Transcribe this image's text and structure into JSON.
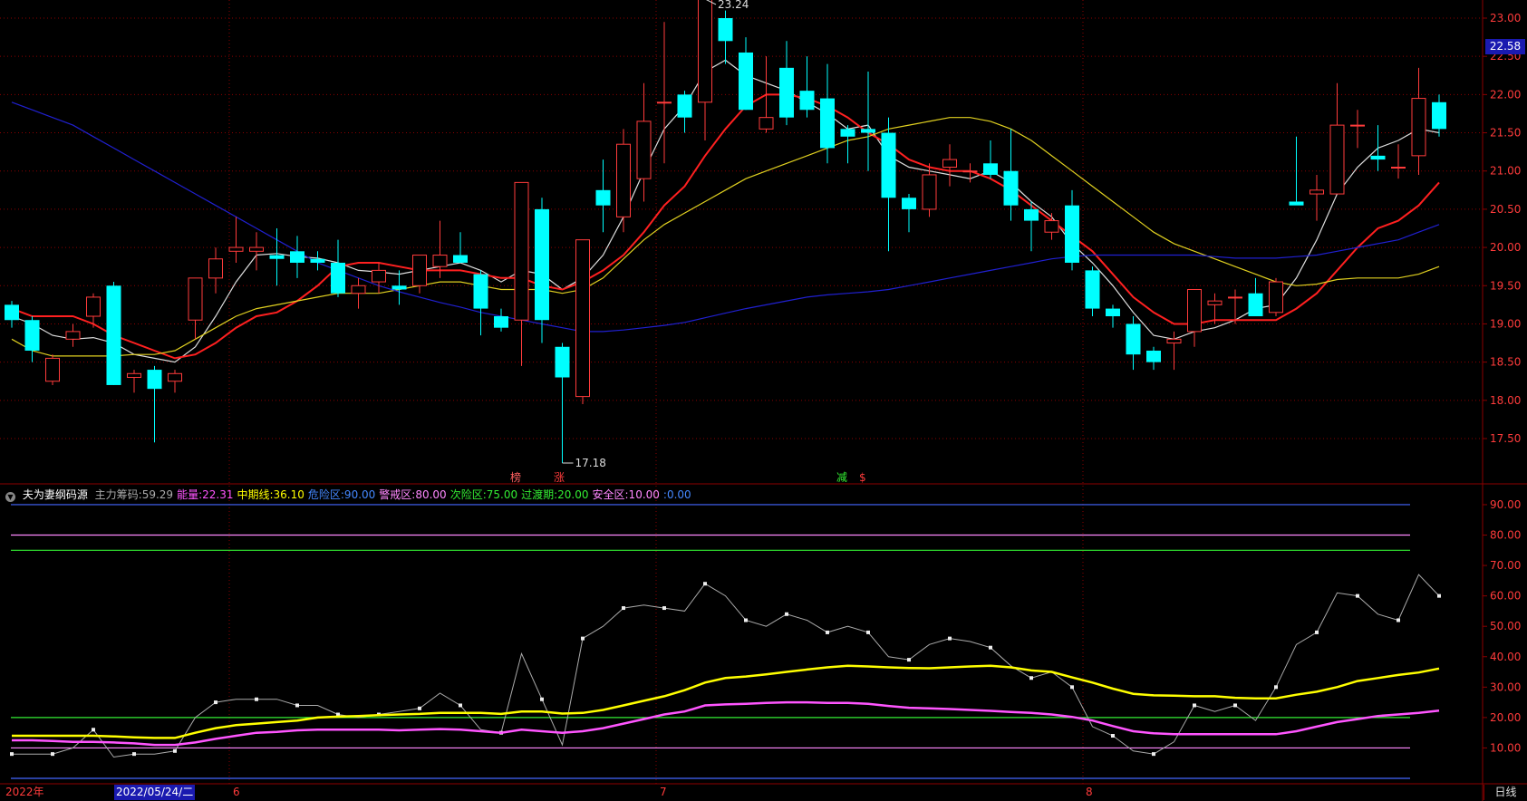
{
  "current_price": "22.58",
  "period": "日线",
  "indicator_header": {
    "name": "夫为妻纲码源",
    "items": [
      {
        "label": "主力筹码:",
        "value": "59.29",
        "color": "#aaaaaa"
      },
      {
        "label": "能量:",
        "value": "22.31",
        "color": "#ff55ff"
      },
      {
        "label": "中期线:",
        "value": "36.10",
        "color": "#ffff00"
      },
      {
        "label": "危险区:",
        "value": "90.00",
        "color": "#4488ff"
      },
      {
        "label": "警戒区:",
        "value": "80.00",
        "color": "#ff88ff"
      },
      {
        "label": "次险区:",
        "value": "75.00",
        "color": "#33ee33"
      },
      {
        "label": "过渡期:",
        "value": "20.00",
        "color": "#33ee33"
      },
      {
        "label": "安全区:",
        "value": "10.00",
        "color": "#ff88ff"
      },
      {
        "label": ":",
        "value": "0.00",
        "color": "#4488ff"
      }
    ]
  },
  "date_axis": {
    "year": "2022年",
    "cursor": "2022/05/24/二",
    "m6": "6",
    "m7": "7",
    "m8": "8"
  },
  "colors": {
    "up": "#ff3b3b",
    "down": "#00ffff",
    "ma_white": "#dddddd",
    "ma_red": "#ff2020",
    "ma_yellow": "#e0d020",
    "ma_blue": "#2020d0",
    "axis": "#8b0000",
    "energy": "#ff55ff",
    "midline": "#ffff00",
    "main": "#aaaaaa"
  },
  "chart_data": [
    {
      "type": "candlestick",
      "ylim": [
        17.0,
        23.2
      ],
      "yticks": [
        17.5,
        18.0,
        18.5,
        19.0,
        19.5,
        20.0,
        20.5,
        21.0,
        21.5,
        22.0,
        22.5,
        23.0
      ],
      "annotations": {
        "high_label": "23.24",
        "low_label": "17.18",
        "signals": [
          "榜",
          "涨",
          "减",
          "$"
        ]
      },
      "ohlc": [
        [
          19.25,
          19.3,
          18.95,
          19.05
        ],
        [
          19.05,
          19.1,
          18.5,
          18.65
        ],
        [
          18.25,
          18.6,
          18.2,
          18.55
        ],
        [
          18.8,
          19.0,
          18.7,
          18.9
        ],
        [
          19.1,
          19.4,
          18.95,
          19.35
        ],
        [
          19.5,
          19.55,
          18.2,
          18.2
        ],
        [
          18.3,
          18.4,
          18.1,
          18.35
        ],
        [
          18.4,
          18.45,
          17.45,
          18.15
        ],
        [
          18.25,
          18.4,
          18.1,
          18.35
        ],
        [
          19.05,
          19.6,
          18.8,
          19.6
        ],
        [
          19.6,
          20.0,
          19.4,
          19.85
        ],
        [
          19.95,
          20.4,
          19.8,
          20.0
        ],
        [
          19.95,
          20.2,
          19.7,
          20.0
        ],
        [
          19.9,
          20.25,
          19.5,
          19.85
        ],
        [
          19.95,
          20.15,
          19.6,
          19.8
        ],
        [
          19.85,
          19.95,
          19.7,
          19.8
        ],
        [
          19.8,
          20.1,
          19.35,
          19.4
        ],
        [
          19.4,
          19.6,
          19.2,
          19.5
        ],
        [
          19.55,
          19.8,
          19.4,
          19.7
        ],
        [
          19.5,
          19.7,
          19.25,
          19.45
        ],
        [
          19.5,
          19.8,
          19.4,
          19.9
        ],
        [
          19.75,
          20.35,
          19.6,
          19.9
        ],
        [
          19.9,
          20.2,
          19.8,
          19.8
        ],
        [
          19.65,
          19.7,
          18.85,
          19.2
        ],
        [
          19.1,
          19.2,
          18.9,
          18.95
        ],
        [
          19.05,
          20.85,
          18.45,
          20.85
        ],
        [
          20.5,
          20.65,
          18.75,
          19.05
        ],
        [
          18.7,
          18.75,
          17.18,
          18.3
        ],
        [
          18.05,
          20.1,
          17.95,
          20.1
        ],
        [
          20.75,
          21.15,
          20.2,
          20.55
        ],
        [
          20.4,
          21.55,
          20.2,
          21.35
        ],
        [
          20.9,
          22.15,
          20.6,
          21.65
        ],
        [
          21.9,
          22.95,
          21.1,
          21.9
        ],
        [
          22.0,
          22.05,
          21.5,
          21.7
        ],
        [
          21.9,
          23.24,
          21.4,
          23.25
        ],
        [
          23.0,
          23.1,
          22.4,
          22.7
        ],
        [
          22.55,
          22.75,
          21.8,
          21.8
        ],
        [
          21.55,
          22.5,
          21.5,
          21.7
        ],
        [
          22.35,
          22.7,
          21.6,
          21.7
        ],
        [
          22.05,
          22.5,
          21.7,
          21.8
        ],
        [
          21.95,
          22.4,
          21.1,
          21.3
        ],
        [
          21.55,
          21.6,
          21.1,
          21.45
        ],
        [
          21.55,
          22.3,
          21.0,
          21.5
        ],
        [
          21.5,
          21.7,
          19.95,
          20.65
        ],
        [
          20.65,
          20.7,
          20.2,
          20.5
        ],
        [
          20.5,
          21.1,
          20.4,
          20.95
        ],
        [
          21.05,
          21.35,
          20.8,
          21.15
        ],
        [
          21.0,
          21.1,
          20.85,
          21.0
        ],
        [
          21.1,
          21.4,
          20.9,
          20.95
        ],
        [
          21.0,
          21.55,
          20.35,
          20.55
        ],
        [
          20.5,
          20.6,
          19.95,
          20.35
        ],
        [
          20.2,
          20.45,
          20.1,
          20.35
        ],
        [
          20.55,
          20.75,
          19.7,
          19.8
        ],
        [
          19.7,
          19.75,
          19.1,
          19.2
        ],
        [
          19.2,
          19.25,
          18.95,
          19.1
        ],
        [
          19.0,
          19.1,
          18.4,
          18.6
        ],
        [
          18.65,
          18.7,
          18.4,
          18.5
        ],
        [
          18.75,
          18.9,
          18.4,
          18.8
        ],
        [
          18.9,
          19.45,
          18.7,
          19.45
        ],
        [
          19.25,
          19.4,
          19.0,
          19.3
        ],
        [
          19.35,
          19.45,
          19.0,
          19.35
        ],
        [
          19.4,
          19.6,
          19.1,
          19.1
        ],
        [
          19.15,
          19.6,
          19.1,
          19.55
        ],
        [
          20.6,
          21.45,
          20.6,
          20.55
        ],
        [
          20.7,
          20.95,
          20.35,
          20.75
        ],
        [
          20.7,
          22.15,
          20.7,
          21.6
        ],
        [
          21.6,
          21.8,
          21.3,
          21.6
        ],
        [
          21.2,
          21.6,
          21.0,
          21.15
        ],
        [
          21.05,
          21.35,
          20.9,
          21.05
        ],
        [
          21.2,
          22.35,
          20.95,
          21.95
        ],
        [
          21.9,
          22.0,
          21.45,
          21.55
        ]
      ],
      "series": [
        {
          "name": "",
          "color": "#dddddd",
          "values": [
            19.1,
            19.0,
            18.85,
            18.8,
            18.82,
            18.75,
            18.6,
            18.55,
            18.5,
            18.7,
            19.1,
            19.55,
            19.9,
            19.92,
            19.88,
            19.86,
            19.8,
            19.7,
            19.68,
            19.65,
            19.7,
            19.75,
            19.8,
            19.7,
            19.55,
            19.7,
            19.65,
            19.45,
            19.6,
            19.9,
            20.4,
            21.0,
            21.55,
            21.85,
            22.3,
            22.45,
            22.25,
            22.15,
            22.05,
            21.9,
            21.75,
            21.55,
            21.6,
            21.2,
            21.05,
            21.0,
            20.95,
            20.9,
            21.0,
            20.85,
            20.6,
            20.4,
            20.05,
            19.8,
            19.5,
            19.15,
            18.85,
            18.8,
            18.9,
            18.95,
            19.05,
            19.2,
            19.25,
            19.6,
            20.1,
            20.7,
            21.05,
            21.3,
            21.4,
            21.55,
            21.5
          ]
        },
        {
          "name": "",
          "color": "#ff2020",
          "values": [
            19.2,
            19.1,
            19.1,
            19.1,
            19.0,
            18.85,
            18.75,
            18.65,
            18.55,
            18.6,
            18.75,
            18.95,
            19.1,
            19.15,
            19.3,
            19.5,
            19.75,
            19.8,
            19.8,
            19.75,
            19.7,
            19.7,
            19.7,
            19.65,
            19.6,
            19.6,
            19.5,
            19.45,
            19.55,
            19.7,
            19.9,
            20.2,
            20.55,
            20.8,
            21.2,
            21.55,
            21.85,
            22.0,
            22.0,
            21.95,
            21.85,
            21.7,
            21.5,
            21.35,
            21.15,
            21.05,
            21.0,
            21.0,
            20.9,
            20.75,
            20.55,
            20.35,
            20.15,
            19.95,
            19.65,
            19.35,
            19.15,
            19.0,
            19.0,
            19.05,
            19.05,
            19.05,
            19.05,
            19.2,
            19.4,
            19.7,
            20.0,
            20.25,
            20.35,
            20.55,
            20.85
          ]
        },
        {
          "name": "",
          "color": "#e0d020",
          "values": [
            18.8,
            18.65,
            18.58,
            18.58,
            18.58,
            18.58,
            18.6,
            18.6,
            18.65,
            18.8,
            18.95,
            19.1,
            19.2,
            19.25,
            19.3,
            19.35,
            19.4,
            19.4,
            19.4,
            19.45,
            19.5,
            19.55,
            19.55,
            19.5,
            19.45,
            19.45,
            19.45,
            19.4,
            19.45,
            19.6,
            19.85,
            20.1,
            20.3,
            20.45,
            20.6,
            20.75,
            20.9,
            21.0,
            21.1,
            21.2,
            21.3,
            21.4,
            21.45,
            21.55,
            21.6,
            21.65,
            21.7,
            21.7,
            21.65,
            21.55,
            21.4,
            21.2,
            21.0,
            20.8,
            20.6,
            20.4,
            20.2,
            20.05,
            19.95,
            19.85,
            19.75,
            19.65,
            19.55,
            19.5,
            19.52,
            19.58,
            19.6,
            19.6,
            19.6,
            19.65,
            19.75
          ]
        },
        {
          "name": "",
          "color": "#2020d0",
          "values": [
            21.9,
            21.8,
            21.7,
            21.6,
            21.45,
            21.3,
            21.15,
            21.0,
            20.85,
            20.7,
            20.55,
            20.4,
            20.25,
            20.1,
            19.95,
            19.8,
            19.7,
            19.6,
            19.5,
            19.42,
            19.35,
            19.28,
            19.22,
            19.15,
            19.1,
            19.05,
            19.0,
            18.95,
            18.9,
            18.9,
            18.92,
            18.95,
            18.98,
            19.02,
            19.08,
            19.14,
            19.2,
            19.25,
            19.3,
            19.35,
            19.38,
            19.4,
            19.42,
            19.45,
            19.5,
            19.55,
            19.6,
            19.65,
            19.7,
            19.75,
            19.8,
            19.85,
            19.88,
            19.9,
            19.9,
            19.9,
            19.9,
            19.9,
            19.9,
            19.88,
            19.86,
            19.86,
            19.86,
            19.88,
            19.9,
            19.95,
            20.0,
            20.05,
            20.1,
            20.2,
            20.3
          ]
        }
      ]
    },
    {
      "type": "line",
      "ylim": [
        0,
        95
      ],
      "yticks": [
        10.0,
        20.0,
        30.0,
        40.0,
        50.0,
        60.0,
        70.0,
        80.0,
        90.0
      ],
      "hlines": [
        {
          "value": 90,
          "color": "#4466ff"
        },
        {
          "value": 80,
          "color": "#ff88ff"
        },
        {
          "value": 75,
          "color": "#33ee33"
        },
        {
          "value": 20,
          "color": "#33ee33"
        },
        {
          "value": 10,
          "color": "#ff88ff"
        },
        {
          "value": 0,
          "color": "#4466ff"
        }
      ],
      "series": [
        {
          "name": "主力筹码",
          "color": "#aaaaaa",
          "values": [
            8,
            8,
            8,
            10,
            16,
            7,
            8,
            8,
            9,
            20,
            25,
            26,
            26,
            26,
            24,
            24,
            21,
            20,
            21,
            22,
            23,
            28,
            24,
            16,
            15,
            41,
            26,
            11,
            46,
            50,
            56,
            57,
            56,
            55,
            64,
            60,
            52,
            50,
            54,
            52,
            48,
            50,
            48,
            40,
            39,
            44,
            46,
            45,
            43,
            37,
            33,
            35,
            30,
            17,
            14,
            9,
            8,
            12,
            24,
            22,
            24,
            19,
            30,
            44,
            48,
            61,
            60,
            54,
            52,
            67,
            60
          ]
        },
        {
          "name": "能量",
          "color": "#ff55ff",
          "values": [
            12.5,
            12.5,
            12.3,
            12,
            12,
            11.8,
            11.5,
            11,
            11,
            11.8,
            13,
            14,
            15,
            15.3,
            15.8,
            16,
            16,
            16,
            16,
            15.8,
            16,
            16.2,
            16,
            15.5,
            15,
            16,
            15.5,
            15,
            15.5,
            16.5,
            18,
            19.5,
            21,
            22,
            24,
            24.3,
            24.5,
            24.8,
            25,
            25,
            24.8,
            24.8,
            24.5,
            23.8,
            23.2,
            23,
            22.8,
            22.5,
            22.2,
            21.8,
            21.5,
            21,
            20.2,
            19,
            17.2,
            15.5,
            14.8,
            14.5,
            14.5,
            14.5,
            14.5,
            14.5,
            14.5,
            15.5,
            17,
            18.5,
            19.5,
            20.5,
            21,
            21.5,
            22.3
          ]
        },
        {
          "name": "中期线",
          "color": "#ffff00",
          "values": [
            14,
            14,
            14,
            14,
            14,
            13.8,
            13.5,
            13.3,
            13.3,
            15,
            16.5,
            17.5,
            18,
            18.5,
            19,
            20,
            20.3,
            20.5,
            20.8,
            21,
            21.2,
            21.5,
            21.5,
            21.5,
            21.2,
            22,
            22,
            21.3,
            21.5,
            22.5,
            24,
            25.5,
            27,
            29,
            31.5,
            33,
            33.5,
            34.2,
            35,
            35.8,
            36.5,
            37,
            36.8,
            36.5,
            36.3,
            36.2,
            36.5,
            36.8,
            37,
            36.5,
            35.5,
            35,
            33.2,
            31.5,
            29.5,
            27.8,
            27.3,
            27.2,
            27,
            27,
            26.5,
            26.3,
            26.3,
            27.5,
            28.5,
            30,
            32,
            33,
            34,
            34.8,
            36.1
          ]
        }
      ]
    }
  ]
}
